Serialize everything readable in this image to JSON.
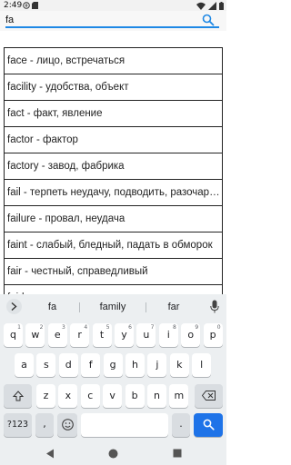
{
  "status_bar": {
    "time": "2:49"
  },
  "search": {
    "value": "fa"
  },
  "word_list": [
    "face - лицо,  встречаться",
    "facility - удобства,  объект",
    "fact - факт,  явление",
    "factor - фактор",
    "factory - завод,  фабрика",
    "fail - терпеть неудачу,  подводить,  разочаровывать",
    "failure - провал,  неудача",
    "faint - слабый,  бледный,  падать в обморок",
    "fair - честный,  справедливый",
    "fairly - довольно-таки,  достаточно"
  ],
  "keyboard": {
    "suggestions": [
      "fa",
      "family",
      "far"
    ],
    "row1": [
      "q",
      "w",
      "e",
      "r",
      "t",
      "y",
      "u",
      "i",
      "o",
      "p"
    ],
    "row1_hints": [
      "1",
      "2",
      "3",
      "4",
      "5",
      "6",
      "7",
      "8",
      "9",
      "0"
    ],
    "row2": [
      "a",
      "s",
      "d",
      "f",
      "g",
      "h",
      "j",
      "k",
      "l"
    ],
    "row3": [
      "z",
      "x",
      "c",
      "v",
      "b",
      "n",
      "m"
    ],
    "symbols_label": "?123",
    "comma_label": ",",
    "period_label": ".",
    "accent_color": "#1e73e8"
  },
  "icons": {
    "search": "search-icon",
    "expand": "chevron-right-icon",
    "mic": "mic-icon",
    "shift": "shift-icon",
    "backspace": "backspace-icon",
    "emoji": "emoji-icon",
    "search_action": "search-action-icon"
  }
}
